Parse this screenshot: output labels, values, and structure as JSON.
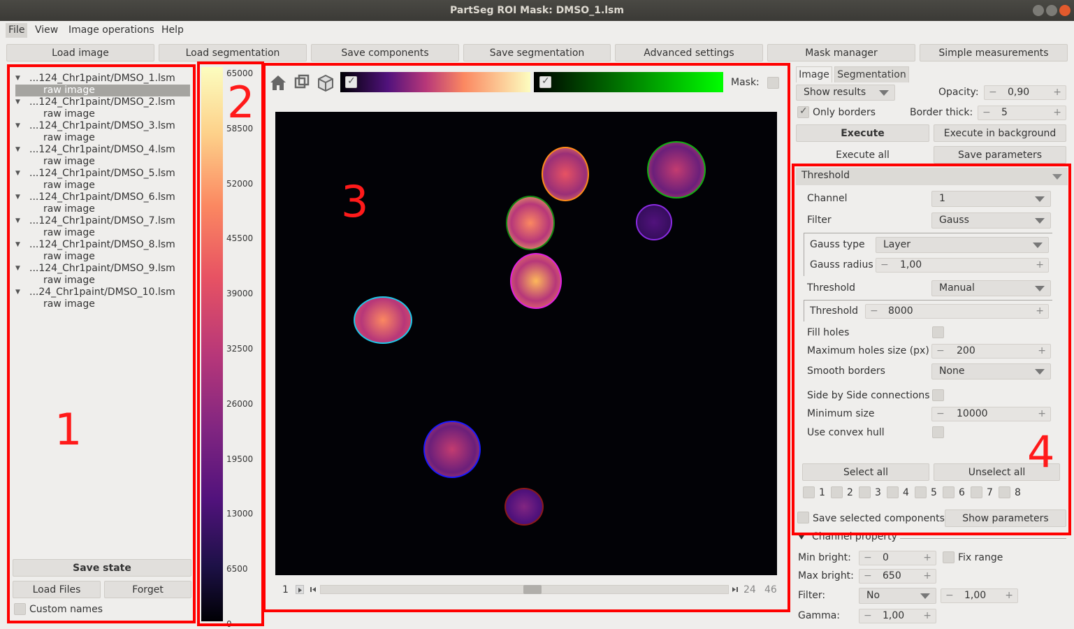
{
  "window": {
    "title": "PartSeg ROI Mask: DMSO_1.lsm"
  },
  "menu": [
    "File",
    "View",
    "Image operations",
    "Help"
  ],
  "toolbar": [
    "Load image",
    "Load segmentation",
    "Save components",
    "Save segmentation",
    "Advanced settings",
    "Mask manager",
    "Simple measurements"
  ],
  "annotations": [
    "1",
    "2",
    "3",
    "4"
  ],
  "file_list": {
    "items": [
      {
        "file": "...124_Chr1paint/DMSO_1.lsm",
        "sub": "raw image"
      },
      {
        "file": "...124_Chr1paint/DMSO_2.lsm",
        "sub": "raw image"
      },
      {
        "file": "...124_Chr1paint/DMSO_3.lsm",
        "sub": "raw image"
      },
      {
        "file": "...124_Chr1paint/DMSO_4.lsm",
        "sub": "raw image"
      },
      {
        "file": "...124_Chr1paint/DMSO_5.lsm",
        "sub": "raw image"
      },
      {
        "file": "...124_Chr1paint/DMSO_6.lsm",
        "sub": "raw image"
      },
      {
        "file": "...124_Chr1paint/DMSO_7.lsm",
        "sub": "raw image"
      },
      {
        "file": "...124_Chr1paint/DMSO_8.lsm",
        "sub": "raw image"
      },
      {
        "file": "...124_Chr1paint/DMSO_9.lsm",
        "sub": "raw image"
      },
      {
        "file": "...24_Chr1paint/DMSO_10.lsm",
        "sub": "raw image"
      }
    ],
    "save_state": "Save state",
    "load_files": "Load Files",
    "forget": "Forget",
    "custom_names": "Custom names"
  },
  "colorbar": {
    "ticks": [
      "65000",
      "58500",
      "52000",
      "45500",
      "39000",
      "32500",
      "26000",
      "19500",
      "13000",
      "6500",
      "0"
    ]
  },
  "viewer": {
    "mask_label": "Mask:",
    "slider_start": "1",
    "slider_value": "24",
    "slider_max": "46"
  },
  "seg_panel": {
    "tabs": [
      "Image",
      "Segmentation"
    ],
    "show_results": "Show results",
    "opacity_label": "Opacity:",
    "opacity_value": "0,90",
    "only_borders": "Only borders",
    "border_thick_label": "Border thick:",
    "border_thick_value": "5",
    "execute": "Execute",
    "execute_bg": "Execute in background",
    "execute_all": "Execute all",
    "save_params": "Save parameters"
  },
  "algo": {
    "name": "Threshold",
    "channel_label": "Channel",
    "channel_value": "1",
    "filter_label": "Filter",
    "filter_value": "Gauss",
    "gauss_type_label": "Gauss type",
    "gauss_type_value": "Layer",
    "gauss_radius_label": "Gauss radius",
    "gauss_radius_value": "1,00",
    "threshold_label": "Threshold",
    "threshold_value": "Manual",
    "threshold2_label": "Threshold",
    "threshold2_value": "8000",
    "fill_holes": "Fill holes",
    "max_holes_label": "Maximum holes size (px)",
    "max_holes_value": "200",
    "smooth_label": "Smooth borders",
    "smooth_value": "None",
    "side_by_side": "Side by Side connections",
    "min_size_label": "Minimum size",
    "min_size_value": "10000",
    "convex_hull": "Use convex hull",
    "select_all": "Select all",
    "unselect_all": "Unselect all",
    "components": [
      "1",
      "2",
      "3",
      "4",
      "5",
      "6",
      "7",
      "8"
    ],
    "save_selected": "Save selected components",
    "show_params": "Show parameters"
  },
  "channel_prop": {
    "title": "Channel property",
    "min_bright_label": "Min bright:",
    "min_bright_value": "0",
    "fix_range": "Fix range",
    "max_bright_label": "Max bright:",
    "max_bright_value": "650",
    "filter_label": "Filter:",
    "filter_value": "No",
    "filter_radius": "1,00",
    "gamma_label": "Gamma:",
    "gamma_value": "1,00"
  }
}
